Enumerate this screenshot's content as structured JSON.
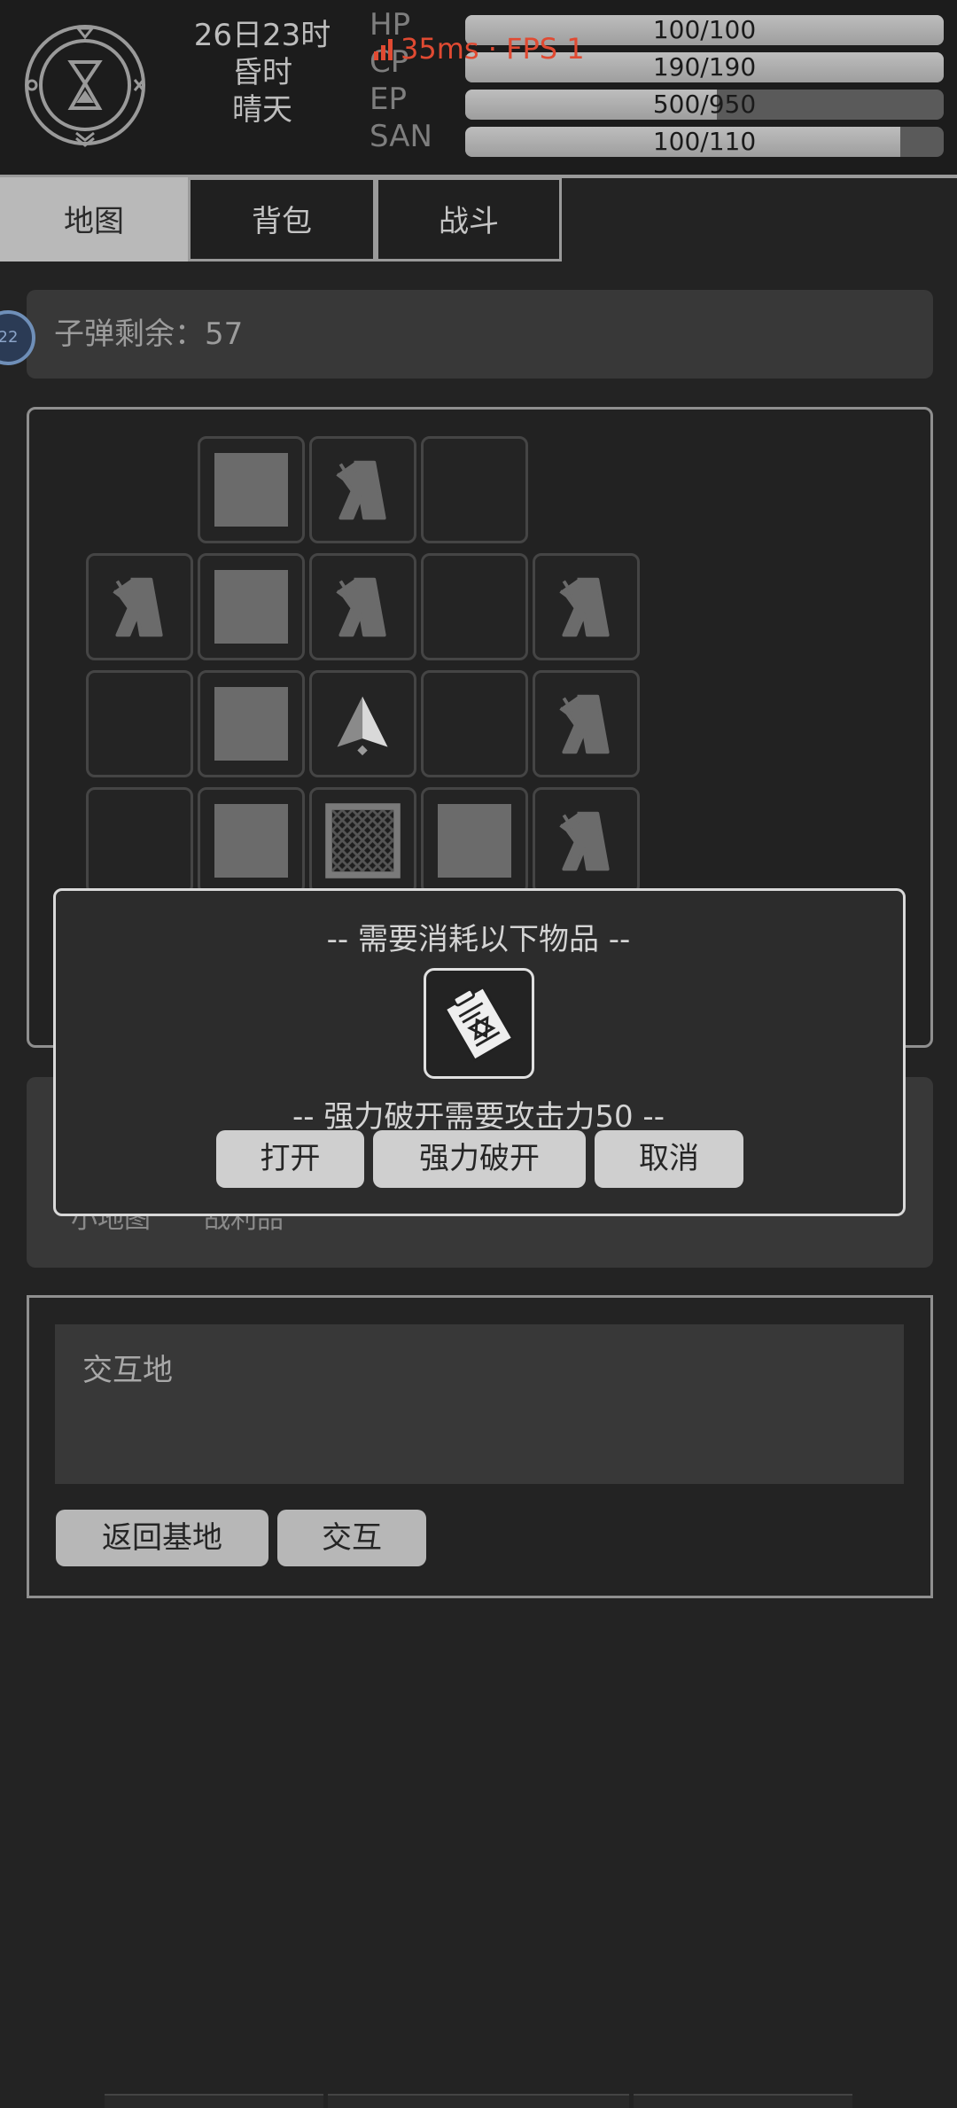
{
  "header": {
    "date": "26日23时",
    "period": "昏时",
    "weather": "晴天",
    "fps_text": "35ms · FPS 1",
    "stats": [
      {
        "label": "HP",
        "text": "100/100",
        "fraction": 1.0
      },
      {
        "label": "CP",
        "text": "190/190",
        "fraction": 1.0
      },
      {
        "label": "EP",
        "text": "500/950",
        "fraction": 0.526
      },
      {
        "label": "SAN",
        "text": "100/110",
        "fraction": 0.909
      }
    ]
  },
  "tabs": [
    {
      "label": "地图",
      "active": true
    },
    {
      "label": "背包",
      "active": false
    },
    {
      "label": "战斗",
      "active": false
    }
  ],
  "level_badge": "22",
  "ammo": {
    "label": "子弹剩余：57"
  },
  "map": {
    "rows": [
      [
        "none",
        "none",
        "wall",
        "tree",
        "empty",
        "none",
        "none"
      ],
      [
        "none",
        "tree",
        "wall",
        "tree",
        "empty",
        "tree",
        "none"
      ],
      [
        "none",
        "empty",
        "wall",
        "player",
        "empty",
        "tree",
        "none"
      ],
      [
        "none",
        "empty",
        "wall",
        "crate",
        "wall",
        "tree",
        "none"
      ]
    ]
  },
  "subtabs": [
    "小地图",
    "战利品"
  ],
  "interact": {
    "label": "交互地",
    "buttons": [
      "返回基地",
      "交互"
    ]
  },
  "modal": {
    "title": "-- 需要消耗以下物品 --",
    "item_icon": "lockpick-document-icon",
    "cost": "-- 强力破开需要攻击力50 --",
    "buttons": [
      "打开",
      "强力破开",
      "取消"
    ]
  },
  "colors": {
    "background": "#232323",
    "fps": "#e04a32",
    "modal_border": "#d9d9d9"
  }
}
